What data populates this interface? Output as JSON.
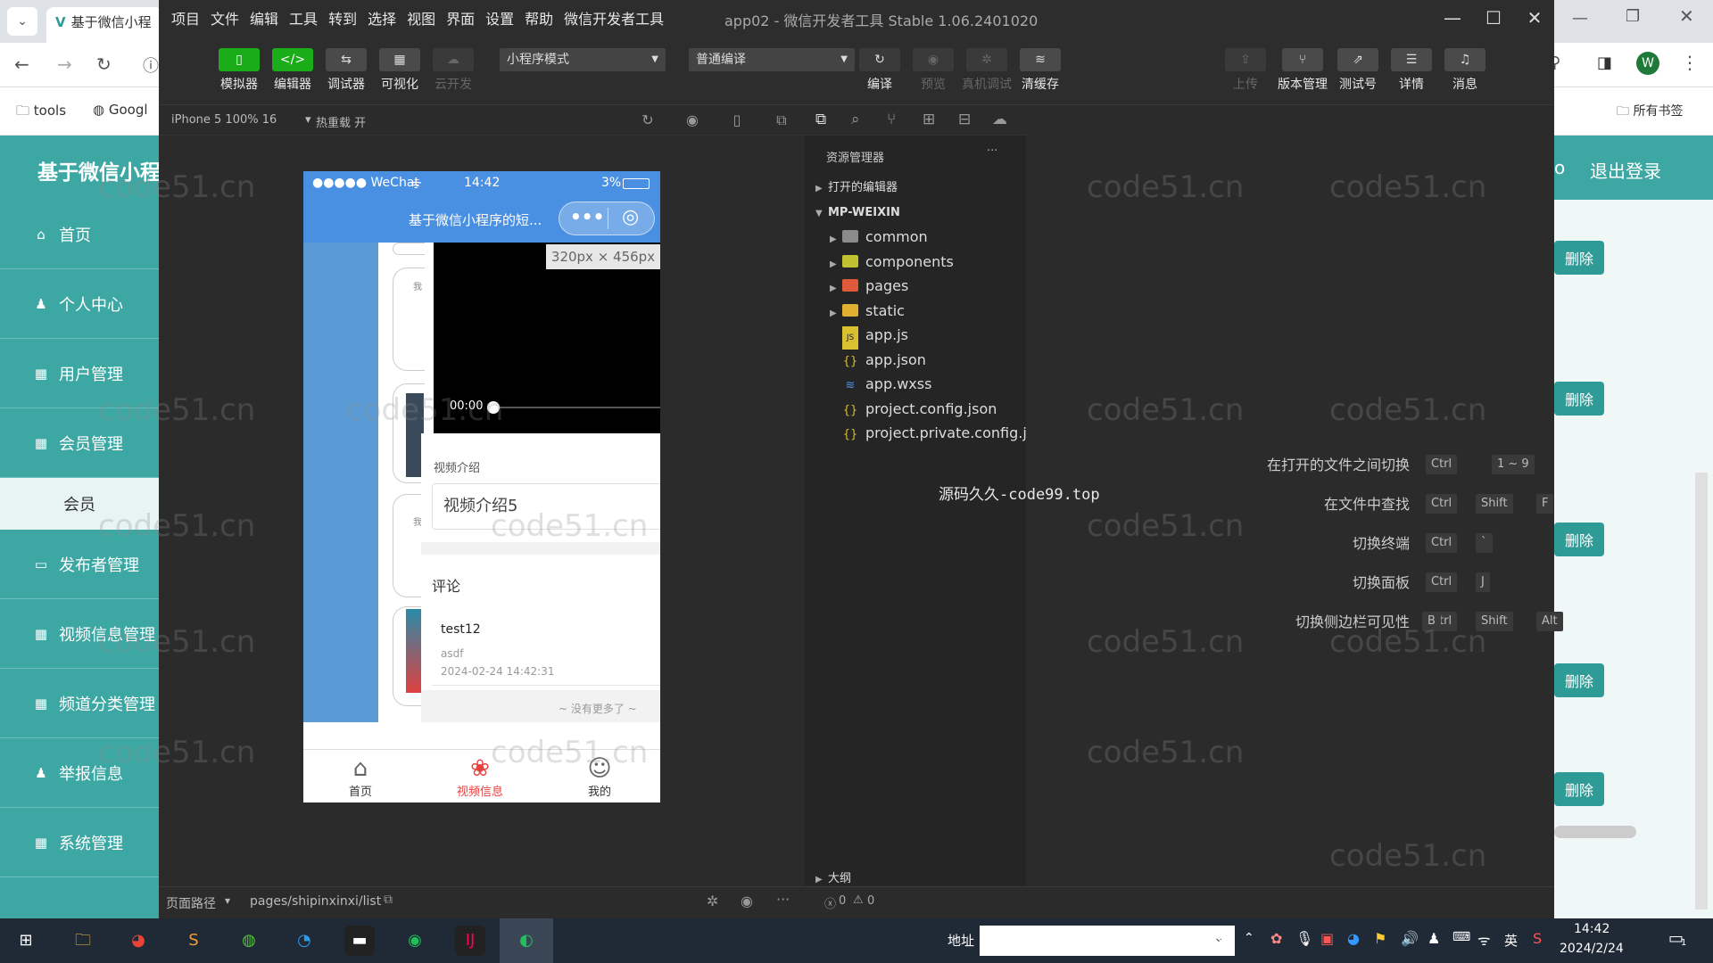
{
  "browser": {
    "tab_title": "基于微信小程",
    "bookmarks": [
      "tools",
      "Googl"
    ],
    "all_bookmarks": "所有书签",
    "profile_letter": "W"
  },
  "admin": {
    "header_title": "基于微信小程",
    "header_right": "o",
    "logout": "退出登录",
    "sidebar": [
      {
        "label": "首页",
        "icon": "home-icon"
      },
      {
        "label": "个人中心",
        "icon": "user-icon"
      },
      {
        "label": "用户管理",
        "icon": "grid-icon"
      },
      {
        "label": "会员管理",
        "icon": "grid-icon"
      },
      {
        "label": "会员",
        "icon": ""
      },
      {
        "label": "发布者管理",
        "icon": "monitor-icon"
      },
      {
        "label": "视频信息管理",
        "icon": "grid-icon"
      },
      {
        "label": "频道分类管理",
        "icon": "grid-icon"
      },
      {
        "label": "举报信息",
        "icon": "user-icon"
      },
      {
        "label": "系统管理",
        "icon": "grid-icon"
      }
    ],
    "delete_label": "删除"
  },
  "devtools": {
    "menu": [
      "项目",
      "文件",
      "编辑",
      "工具",
      "转到",
      "选择",
      "视图",
      "界面",
      "设置",
      "帮助",
      "微信开发者工具"
    ],
    "window_title": "app02 - 微信开发者工具 Stable 1.06.2401020",
    "toolbar_left": [
      {
        "label": "模拟器",
        "icon": "phone-icon",
        "glyph": "▯"
      },
      {
        "label": "编辑器",
        "icon": "code-icon",
        "glyph": "</>"
      },
      {
        "label": "调试器",
        "icon": "debug-icon",
        "glyph": "⇆"
      },
      {
        "label": "可视化",
        "icon": "layout-icon",
        "glyph": "▦"
      },
      {
        "label": "云开发",
        "icon": "cloud-icon",
        "glyph": "☁"
      }
    ],
    "mode_select": "小程序模式",
    "compile_select": "普通编译",
    "toolbar_mid": [
      "编译",
      "预览",
      "真机调试",
      "清缓存"
    ],
    "toolbar_right": [
      "上传",
      "版本管理",
      "测试号",
      "详情",
      "消息"
    ],
    "device": "iPhone 5 100% 16",
    "hot_reload": "热重载 开",
    "explorer_title": "资源管理器",
    "open_editors": "打开的编辑器",
    "project_root": "MP-WEIXIN",
    "tree": [
      {
        "name": "common",
        "type": "folder",
        "color": "#8a8a8a"
      },
      {
        "name": "components",
        "type": "folder",
        "color": "#c0c030"
      },
      {
        "name": "pages",
        "type": "folder",
        "color": "#e05a3a"
      },
      {
        "name": "static",
        "type": "folder",
        "color": "#e0b030"
      },
      {
        "name": "app.js",
        "type": "js"
      },
      {
        "name": "app.json",
        "type": "json"
      },
      {
        "name": "app.wxss",
        "type": "wxss"
      },
      {
        "name": "project.config.json",
        "type": "json"
      },
      {
        "name": "project.private.config.js...",
        "type": "json"
      }
    ],
    "outline": "大纲",
    "problems": "0",
    "warnings": "0",
    "center_text": "源码久久-code99.top",
    "shortcuts": [
      {
        "label": "在打开的文件之间切换",
        "keys": [
          "Ctrl",
          "1 ~ 9"
        ]
      },
      {
        "label": "在文件中查找",
        "keys": [
          "Ctrl",
          "Shift",
          "F"
        ]
      },
      {
        "label": "切换终端",
        "keys": [
          "Ctrl",
          "`"
        ]
      },
      {
        "label": "切换面板",
        "keys": [
          "Ctrl",
          "J"
        ]
      },
      {
        "label": "切换侧边栏可见性",
        "keys": [
          "Ctrl",
          "Shift",
          "Alt",
          "B"
        ]
      }
    ],
    "page_path_label": "页面路径",
    "page_path": "pages/shipinxinxi/list"
  },
  "phone": {
    "carrier": "●●●●● WeChat",
    "time": "14:42",
    "battery": "3%",
    "nav_title": "基于微信小程序的短...",
    "size_tip": "320px × 456px",
    "video_time": "00:00",
    "intro_label": "视频介绍",
    "intro_text": "视频介绍5",
    "comments_label": "评论",
    "comment": {
      "user": "test12",
      "text": "asdf",
      "time": "2024-02-24 14:42:31"
    },
    "no_more": "~ 没有更多了 ~",
    "card_char": "我",
    "tabs": [
      {
        "label": "首页",
        "icon": "home-icon",
        "glyph": "⌂",
        "active": false
      },
      {
        "label": "视频信息",
        "icon": "video-grid-icon",
        "glyph": "❀",
        "active": true
      },
      {
        "label": "我的",
        "icon": "person-icon",
        "glyph": "☺",
        "active": false
      }
    ]
  },
  "watermark": "code51.cn",
  "taskbar": {
    "address_label": "地址",
    "ime": "英",
    "time": "14:42",
    "date": "2024/2/24",
    "notification_count": "1"
  },
  "colors": {
    "admin_teal": "#3da7a3",
    "wechat_green": "#1aad19",
    "phone_blue": "#4a90e2",
    "tab_active": "#e64340"
  }
}
